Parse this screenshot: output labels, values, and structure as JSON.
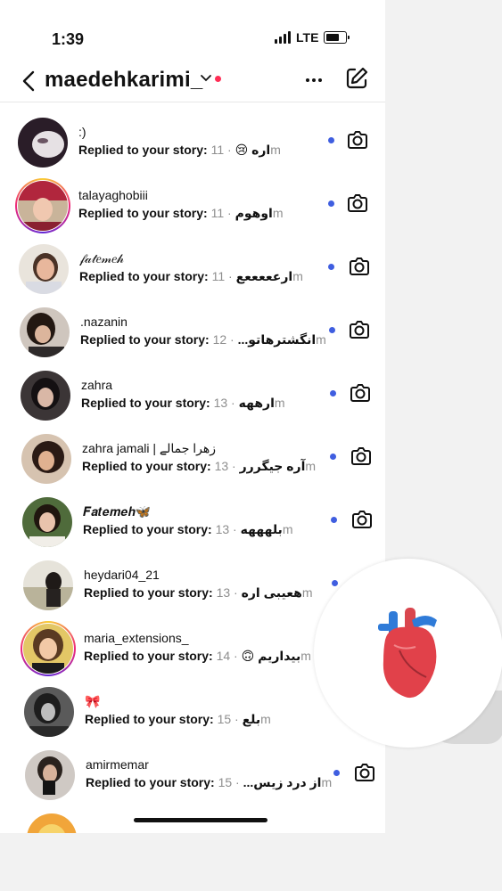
{
  "status": {
    "time": "1:39",
    "network": "LTE"
  },
  "header": {
    "username": "maedehkarimi_",
    "more_icon": "ellipsis-icon",
    "compose_icon": "compose-icon"
  },
  "colors": {
    "unread_dot": "#3f5ee0",
    "notification_dot": "#ff2d55",
    "story_ring": "#ee2a7b"
  },
  "messages": [
    {
      "name": ":)",
      "text": "Replied to your story: اره 😢",
      "time": " · 11m",
      "unread": true,
      "camera": true
    },
    {
      "name": "talayaghobiii",
      "text": "Replied to your story: اوهوم",
      "time": " · 11m",
      "unread": true,
      "camera": true
    },
    {
      "name": "𝒻𝒶𝓉𝑒𝓂𝑒𝒽",
      "text": "Replied to your story: ارعععععع",
      "time": " · 11m",
      "unread": true,
      "camera": true
    },
    {
      "name": ".nazanin",
      "text": "Replied to your story: انگشترهاتو...",
      "time": " · 12m",
      "unread": true,
      "camera": true
    },
    {
      "name": "zahra",
      "text": "Replied to your story: ارههه",
      "time": " · 13m",
      "unread": true,
      "camera": true
    },
    {
      "name": "zahra jamali | زهرا جمالے",
      "text": "Replied to your story: آره جیگررر",
      "time": " · 13m",
      "unread": true,
      "camera": true
    },
    {
      "name": "𝑭𝒂𝒕𝒆𝒎𝒆𝒉🦋",
      "text": "Replied to your story: بلهههه",
      "time": " · 13m",
      "unread": true,
      "camera": true
    },
    {
      "name": "heydari04_21",
      "text": "Replied to your story: هعیبی اره",
      "time": " · 13m",
      "unread": true,
      "camera": false
    },
    {
      "name": "maria_extensions_",
      "text": "Replied to your story: بیداریم 🙃",
      "time": " · 14m",
      "unread": false,
      "camera": false
    },
    {
      "name": "🎀",
      "text": "Replied to your story: بلع",
      "time": " · 15m",
      "unread": false,
      "camera": false
    },
    {
      "name": "amirmemar",
      "text": "Replied to your story: از درد زیس...",
      "time": " · 15m",
      "unread": true,
      "camera": true
    }
  ],
  "reaction": {
    "emoji_icon": "anatomical-heart-icon"
  }
}
